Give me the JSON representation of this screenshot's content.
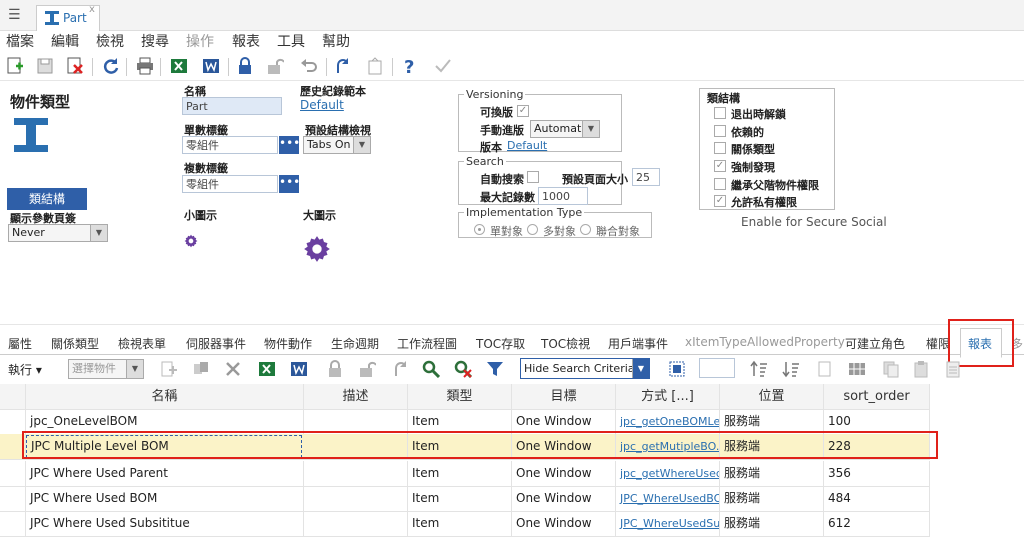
{
  "window": {
    "tab_title": "Part",
    "tab_close": "x"
  },
  "menu": [
    "檔案",
    "編輯",
    "檢視",
    "搜尋",
    "操作",
    "報表",
    "工具",
    "幫助"
  ],
  "form": {
    "title": "物件類型",
    "name_label": "名稱",
    "name_value": "Part",
    "history_label": "歷史紀錄範本",
    "history_value": "Default",
    "singular_label": "單數標籤",
    "singular_value": "零組件",
    "plural_label": "複數標籤",
    "plural_value": "零組件",
    "default_view_label": "預設結構檢視",
    "default_view_value": "Tabs On",
    "small_icon_label": "小圖示",
    "large_icon_label": "大圖示",
    "class_structure_button": "類結構",
    "show_params_label": "顯示參數頁簽",
    "show_params_value": "Never"
  },
  "versioning": {
    "legend": "Versioning",
    "versionable_label": "可換版",
    "manual_label": "手動進版",
    "manual_value": "Automatic",
    "version_label": "版本",
    "version_value": "Default"
  },
  "search": {
    "legend": "Search",
    "auto_label": "自動搜索",
    "page_size_label": "預設頁面大小",
    "page_size_value": "25",
    "max_records_label": "最大記錄數",
    "max_records_value": "1000"
  },
  "implementation": {
    "legend": "Implementation Type",
    "options": [
      "單對象",
      "多對象",
      "聯合對象"
    ]
  },
  "class_structure": {
    "title": "類結構",
    "items": [
      {
        "label": "退出時解鎖",
        "checked": false
      },
      {
        "label": "依賴的",
        "checked": false
      },
      {
        "label": "關係類型",
        "checked": false
      },
      {
        "label": "強制發現",
        "checked": true
      },
      {
        "label": "繼承父階物件權限",
        "checked": false
      },
      {
        "label": "允許私有權限",
        "checked": true
      }
    ],
    "secure_social": "Enable for Secure Social"
  },
  "relationship_tabs": [
    "屬性",
    "關係類型",
    "檢視表單",
    "伺服器事件",
    "物件動作",
    "生命週期",
    "工作流程圖",
    "TOC存取",
    "TOC檢視",
    "用戶端事件",
    "xItemTypeAllowedProperty",
    "可建立角色",
    "權限",
    "報表",
    "多"
  ],
  "active_tab": "報表",
  "grid_toolbar": {
    "run_label": "執行",
    "select_label": "選擇物件",
    "search_mode": "Hide Search Criteria"
  },
  "grid": {
    "columns": [
      "名稱",
      "描述",
      "類型",
      "目標",
      "方式 [...]",
      "位置",
      "sort_order"
    ],
    "rows": [
      [
        "jpc_OneLevelBOM",
        "",
        "Item",
        "One Window",
        "jpc_getOneBOMLe...",
        "服務端",
        "100"
      ],
      [
        "JPC Multiple Level BOM",
        "",
        "Item",
        "One Window",
        "jpc_getMutipleBO...",
        "服務端",
        "228"
      ],
      [
        "JPC Where Used Parent",
        "",
        "Item",
        "One Window",
        "jpc_getWhereUsed...",
        "服務端",
        "356"
      ],
      [
        "JPC Where Used BOM",
        "",
        "Item",
        "One Window",
        "JPC_WhereUsedBOM",
        "服務端",
        "484"
      ],
      [
        "JPC Where Used Subsititue",
        "",
        "Item",
        "One Window",
        "JPC_WhereUsedSu...",
        "服務端",
        "612"
      ]
    ]
  },
  "colors": {
    "accent": "#2f5fa8",
    "highlight": "#e0211a",
    "selected_row": "#fbf3c8"
  }
}
